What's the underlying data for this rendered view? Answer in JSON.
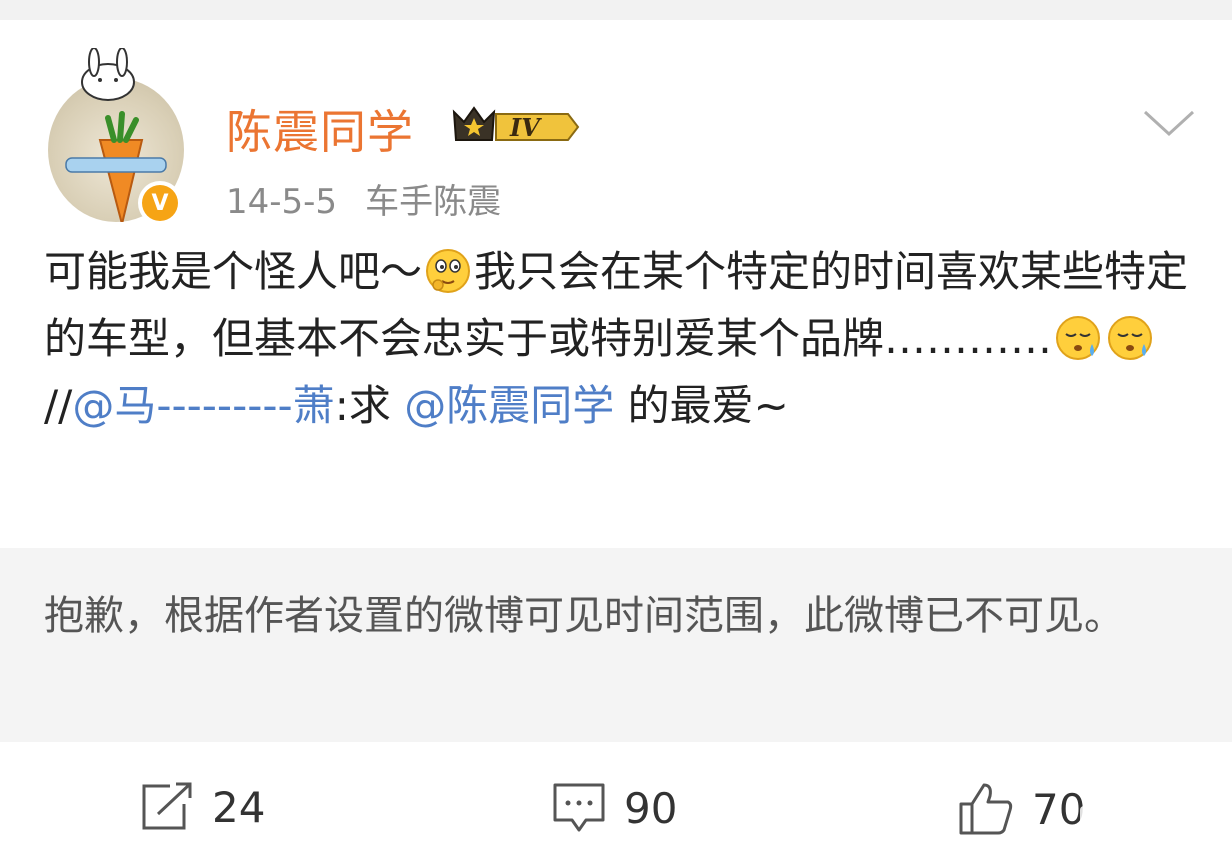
{
  "post": {
    "username": "陈震同学",
    "level_badge": "IV",
    "date": "14-5-5",
    "source": "车手陈震",
    "text_part1": "可能我是个怪人吧～",
    "text_part2": "我只会在某个特定的时间喜欢某些特定的车型，但基本不会忠实于或特别爱某个品牌…………",
    "text_part3": " //",
    "mention1": "@马---------萧",
    "text_part4": ":求 ",
    "mention2": "@陈震同学",
    "text_part5": " 的最爱~"
  },
  "repost_notice": {
    "message": "抱歉，根据作者设置的微博可见时间范围，此微博已不可见。"
  },
  "actions": {
    "repost_count": "24",
    "comment_count": "90",
    "like_count": "70"
  },
  "colors": {
    "username": "#eb7532",
    "link": "#4f7ec7",
    "verified_badge": "#f6a415",
    "notice_bg": "#f4f4f4"
  },
  "icons": {
    "verified": "verified-v-icon",
    "level": "crown-level-icon",
    "menu": "chevron-down-icon",
    "repost": "share-icon",
    "comment": "comment-icon",
    "like": "thumbs-up-icon"
  }
}
